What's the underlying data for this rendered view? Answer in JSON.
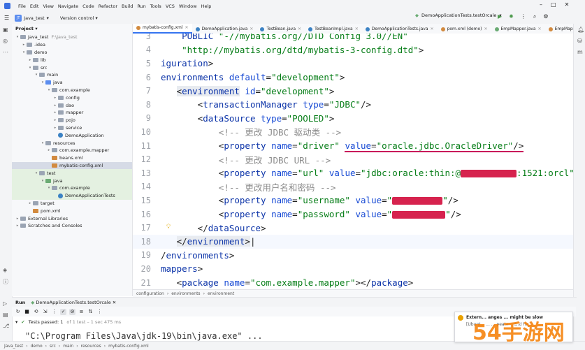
{
  "menu": [
    "File",
    "Edit",
    "View",
    "Navigate",
    "Code",
    "Refactor",
    "Build",
    "Run",
    "Tools",
    "VCS",
    "Window",
    "Help"
  ],
  "toolbar": {
    "project_badge": "JT",
    "project_name": "Java_test",
    "version_control": "Version control",
    "run_config": "DemoApplicationTests.testOrcale"
  },
  "project_panel": {
    "title": "Project",
    "tree": [
      {
        "label": "Java_test",
        "extra": "F:\\Java_test",
        "depth": 0,
        "type": "folder",
        "open": true
      },
      {
        "label": ".idea",
        "depth": 1,
        "type": "folder",
        "open": false
      },
      {
        "label": "demo",
        "depth": 1,
        "type": "folder",
        "open": true
      },
      {
        "label": "lib",
        "depth": 2,
        "type": "folder",
        "open": false
      },
      {
        "label": "src",
        "depth": 2,
        "type": "folder",
        "open": true
      },
      {
        "label": "main",
        "depth": 3,
        "type": "folder",
        "open": true
      },
      {
        "label": "java",
        "depth": 4,
        "type": "blue",
        "open": true
      },
      {
        "label": "com.example",
        "depth": 5,
        "type": "folder",
        "open": true
      },
      {
        "label": "config",
        "depth": 6,
        "type": "folder",
        "open": false
      },
      {
        "label": "dao",
        "depth": 6,
        "type": "folder",
        "open": false
      },
      {
        "label": "mapper",
        "depth": 6,
        "type": "folder",
        "open": false
      },
      {
        "label": "pojo",
        "depth": 6,
        "type": "folder",
        "open": false
      },
      {
        "label": "service",
        "depth": 6,
        "type": "folder",
        "open": false
      },
      {
        "label": "DemoApplication",
        "depth": 6,
        "type": "cls",
        "leaf": true
      },
      {
        "label": "resources",
        "depth": 4,
        "type": "folder",
        "open": true
      },
      {
        "label": "com.example.mapper",
        "depth": 5,
        "type": "folder",
        "open": false
      },
      {
        "label": "beans.xml",
        "depth": 5,
        "type": "file",
        "leaf": true
      },
      {
        "label": "mybatis-config.xml",
        "depth": 5,
        "type": "file",
        "leaf": true,
        "selected": true
      },
      {
        "label": "test",
        "depth": 3,
        "type": "folder",
        "open": true,
        "green": true
      },
      {
        "label": "java",
        "depth": 4,
        "type": "green",
        "open": true,
        "green": true
      },
      {
        "label": "com.example",
        "depth": 5,
        "type": "folder",
        "open": true,
        "green": true
      },
      {
        "label": "DemoApplicationTests",
        "depth": 6,
        "type": "cls",
        "leaf": true,
        "green": true
      },
      {
        "label": "target",
        "depth": 2,
        "type": "folder",
        "open": false
      },
      {
        "label": "pom.xml",
        "depth": 2,
        "type": "file",
        "leaf": true
      },
      {
        "label": "External Libraries",
        "depth": 0,
        "type": "folder",
        "open": false
      },
      {
        "label": "Scratches and Consoles",
        "depth": 0,
        "type": "folder",
        "open": false
      }
    ]
  },
  "tabs": [
    {
      "label": "mybatis-config.xml",
      "active": true,
      "color": "#d28a3f"
    },
    {
      "label": "DemoApplication.java",
      "color": "#3b82c4"
    },
    {
      "label": "TestBean.java",
      "color": "#3b82c4"
    },
    {
      "label": "TestBeanImpl.java",
      "color": "#3b82c4"
    },
    {
      "label": "DemoApplicationTests.java",
      "color": "#3b82c4"
    },
    {
      "label": "pom.xml (demo)",
      "color": "#d28a3f"
    },
    {
      "label": "EmpMapper.java",
      "color": "#6aab73"
    },
    {
      "label": "EmpMapper.xml",
      "color": "#d28a3f"
    }
  ],
  "editor": {
    "lines": [
      {
        "n": "3",
        "html": "    <span class='t'>PUBLIC</span> <span class='s'>\"-//mybatis.org//DTD Config 3.0//EN\"</span>"
      },
      {
        "n": "4",
        "html": "    <span class='s'>\"http://mybatis.org/dtd/mybatis-3-config.dtd\"</span>&gt;"
      },
      {
        "n": "5",
        "html": "<span class='t'>iguration</span>&gt;"
      },
      {
        "n": "6",
        "html": "<span class='t'>environments</span> <span class='a'>default</span>=<span class='s'>\"development\"</span>&gt;"
      },
      {
        "n": "7",
        "html": "   <span class='hl'>&lt;<span class='t'>environment</span></span> <span class='a'>id</span>=<span class='s'>\"development\"</span>&gt;"
      },
      {
        "n": "8",
        "html": "       &lt;<span class='t'>transactionManager</span> <span class='a'>type</span>=<span class='s'>\"JDBC\"</span>/&gt;"
      },
      {
        "n": "9",
        "html": "       &lt;<span class='t'>dataSource</span> <span class='a'>type</span>=<span class='s'>\"POOLED\"</span>&gt;"
      },
      {
        "n": "10",
        "html": "           <span class='c'>&lt;!-- 更改 JDBC 驱动类 --&gt;</span>"
      },
      {
        "n": "11",
        "html": "           &lt;<span class='t'>property</span> <span class='a'>name</span>=<span class='s'>\"driver\"</span> <span class='under'><span class='a'>value</span>=<span class='s'>\"oracle.jdbc.OracleDriver\"</span>/&gt;</span>"
      },
      {
        "n": "12",
        "html": "           <span class='c'>&lt;!-- 更改 JDBC URL --&gt;</span>"
      },
      {
        "n": "13",
        "html": "           &lt;<span class='t'>property</span> <span class='a'>name</span>=<span class='s'>\"url\"</span> <span class='a'>value</span>=<span class='s'>\"jdbc:oracle:thin:@<span class='redact' style='width:80px'></span>:1521:orcl\"</span>/&gt;"
      },
      {
        "n": "14",
        "html": "           <span class='c'>&lt;!-- 更改用户名和密码 --&gt;</span>"
      },
      {
        "n": "15",
        "html": "           &lt;<span class='t'>property</span> <span class='a'>name</span>=<span class='s'>\"username\"</span> <span class='a'>value</span>=<span class='s'>\"<span class='redact' style='width:72px'></span>\"</span>/&gt;"
      },
      {
        "n": "16",
        "html": "           &lt;<span class='t'>property</span> <span class='a'>name</span>=<span class='s'>\"password\"</span> <span class='a'>value</span>=<span class='s'>\"<span class='redact' style='width:76px'></span>\"</span>/&gt;"
      },
      {
        "n": "17",
        "html": "       &lt;/<span class='t'>dataSource</span>&gt;"
      },
      {
        "n": "18",
        "html": "   <span class='hl'>&lt;/<span class='t'>environment</span>&gt;</span>|",
        "current": true
      },
      {
        "n": "19",
        "html": "/<span class='t'>environments</span>&gt;"
      },
      {
        "n": "20",
        "html": "<span class='t'>mappers</span>&gt;"
      },
      {
        "n": "21",
        "html": "   &lt;<span class='t'>package</span> <span class='a'>name</span>=<span class='s'>\"com.example.mapper\"</span>&gt;&lt;/<span class='t'>package</span>&gt;"
      }
    ]
  },
  "breadcrumb": [
    "configuration",
    "environments",
    "environment"
  ],
  "run_panel": {
    "title": "Run",
    "config_tab": "DemoApplicationTests.testOrcale",
    "tests_passed": "Tests passed: 1",
    "tests_detail": "of 1 test – 1 sec 475 ms",
    "console_line": "\"C:\\Program Files\\Java\\jdk-19\\bin\\java.exe\" ..."
  },
  "status_path": [
    "Java_test",
    "demo",
    "src",
    "main",
    "resources",
    "mybatis-config.xml"
  ],
  "notification": {
    "title": "Extern... anges ... might be slow",
    "body": "[Ubunt... ...  ... peate... and ha..."
  },
  "watermark": "54手游网"
}
